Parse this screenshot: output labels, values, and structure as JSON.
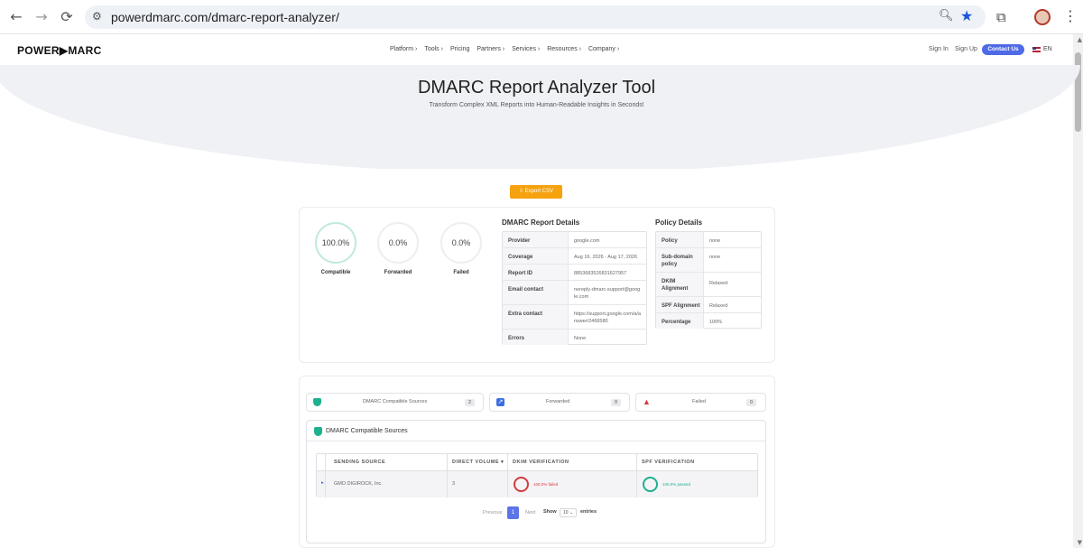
{
  "browser": {
    "url": "powerdmarc.com/dmarc-report-analyzer/",
    "back": "←",
    "forward": "→",
    "reload": "⟳"
  },
  "site": {
    "logo": "POWER▶MARC",
    "nav": [
      "Platform ›",
      "Tools ›",
      "Pricing",
      "Partners ›",
      "Services ›",
      "Resources ›",
      "Company ›"
    ],
    "sign_in": "Sign In",
    "sign_up": "Sign Up",
    "contact": "Contact Us",
    "lang": "EN"
  },
  "hero": {
    "title": "DMARC Report Analyzer Tool",
    "subtitle": "Transform Complex XML Reports into Human-Readable Insights in Seconds!"
  },
  "export_button": "⇩  Export CSV",
  "gauges": [
    {
      "value": "100.0%",
      "label": "Compatible"
    },
    {
      "value": "0.0%",
      "label": "Forwarded"
    },
    {
      "value": "0.0%",
      "label": "Failed"
    }
  ],
  "report_details": {
    "title": "DMARC Report Details",
    "rows": [
      {
        "key": "Provider",
        "value": "google.com"
      },
      {
        "key": "Coverage",
        "value": "Aug 16, 2026 - Aug 17, 2026"
      },
      {
        "key": "Report ID",
        "value": "8853683526831627957"
      },
      {
        "key": "Email contact",
        "value": "noreply-dmarc-support@google.com"
      },
      {
        "key": "Extra contact",
        "value": "https://support.google.com/a/answer/2466580"
      },
      {
        "key": "Errors",
        "value": "None"
      }
    ]
  },
  "policy_details": {
    "title": "Policy Details",
    "rows": [
      {
        "key": "Policy",
        "value": "none"
      },
      {
        "key": "Sub-domain policy",
        "value": "none"
      },
      {
        "key": "DKIM Alignment",
        "value": "Relaxed"
      },
      {
        "key": "SPF Alignment",
        "value": "Relaxed"
      },
      {
        "key": "Percentage",
        "value": "100%"
      }
    ]
  },
  "source_tabs": [
    {
      "label": "DMARC Compatible Sources",
      "count": "2",
      "color": "#1fb08e"
    },
    {
      "label": "Forwarded",
      "count": "0",
      "color": "#3b6fe0"
    },
    {
      "label": "Failed",
      "count": "0",
      "color": "#d43c3c"
    }
  ],
  "sources_section": {
    "title": "DMARC Compatible Sources",
    "columns": [
      "SENDING SOURCE",
      "DIRECT VOLUME ▾",
      "DKIM VERIFICATION",
      "SPF VERIFICATION"
    ],
    "rows": [
      {
        "expander": "▸",
        "source": "GMO DIGIROCK, Inc.",
        "volume": "3",
        "dkim": "100.0% failed",
        "spf": "100.0% passed"
      }
    ]
  },
  "pagination": {
    "previous": "Previous",
    "page": "1",
    "next": "Next",
    "show": "Show",
    "entries_value": "10",
    "entries": "entries"
  }
}
